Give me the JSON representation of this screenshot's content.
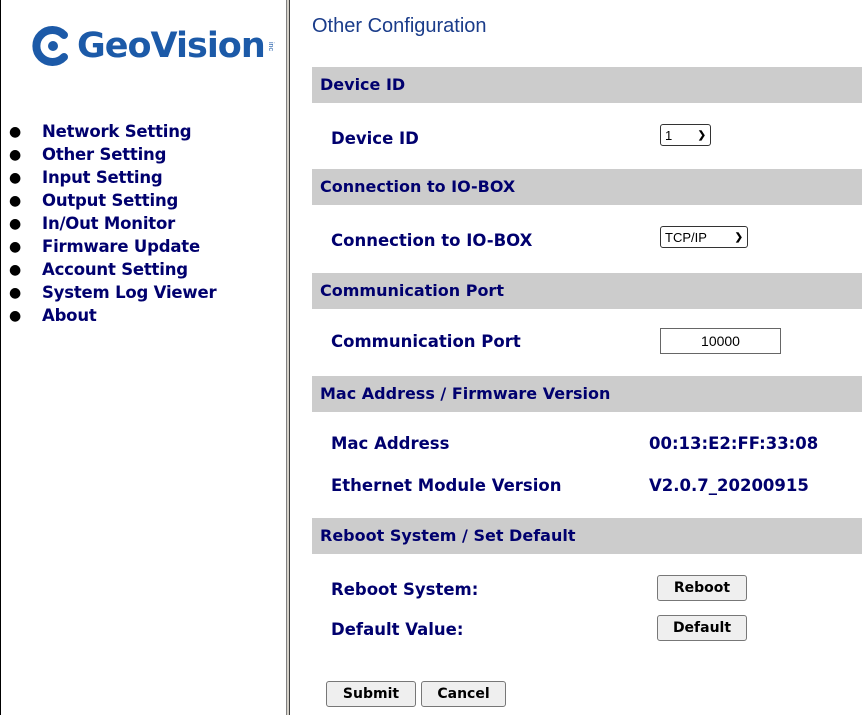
{
  "logo": {
    "brand": "GeoVision",
    "suffix": "inc"
  },
  "nav": {
    "items": [
      {
        "label": "Network Setting"
      },
      {
        "label": "Other Setting"
      },
      {
        "label": "Input Setting"
      },
      {
        "label": "Output Setting"
      },
      {
        "label": "In/Out Monitor"
      },
      {
        "label": "Firmware Update"
      },
      {
        "label": "Account Setting"
      },
      {
        "label": "System Log Viewer"
      },
      {
        "label": "About"
      }
    ]
  },
  "page": {
    "title": "Other Configuration",
    "sections": {
      "device_id": {
        "header": "Device ID",
        "label": "Device ID",
        "selected": "1"
      },
      "connection": {
        "header": "Connection to IO-BOX",
        "label": "Connection to IO-BOX",
        "selected": "TCP/IP"
      },
      "comm_port": {
        "header": "Communication Port",
        "label": "Communication Port",
        "value": "10000"
      },
      "mac_fw": {
        "header": "Mac Address / Firmware Version",
        "mac_label": "Mac Address",
        "mac_value": "00:13:E2:FF:33:08",
        "eth_label": "Ethernet Module Version",
        "eth_value": "V2.0.7_20200915"
      },
      "reboot": {
        "header": "Reboot System / Set Default",
        "reboot_label": "Reboot System:",
        "reboot_button": "Reboot",
        "default_label": "Default Value:",
        "default_button": "Default"
      }
    },
    "submit_button": "Submit",
    "cancel_button": "Cancel"
  },
  "colors": {
    "link": "#00006e",
    "section_bg": "#cccccc",
    "title": "#1a3c8a",
    "logo": "#1c5aa8"
  }
}
